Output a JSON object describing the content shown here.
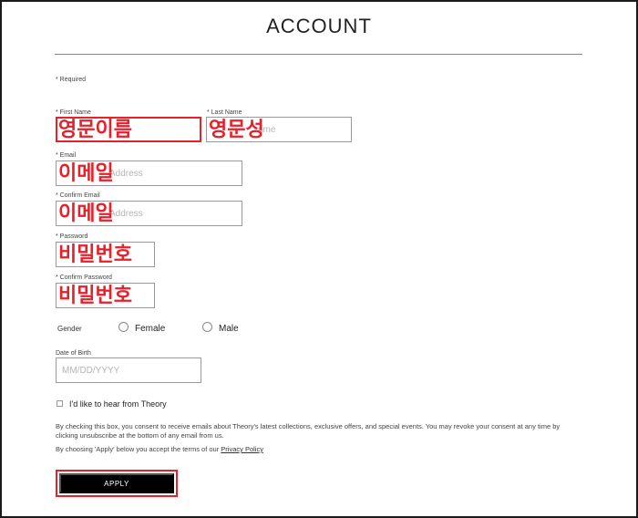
{
  "page": {
    "title": "ACCOUNT",
    "required_note": "* Required"
  },
  "form": {
    "first_name": {
      "label": "* First Name",
      "value": "영문이름",
      "placeholder": ""
    },
    "last_name": {
      "label": "* Last Name",
      "value": "영문성",
      "placeholder": "ame"
    },
    "email": {
      "label": "* Email",
      "value": "이메일",
      "placeholder": "Address"
    },
    "confirm_email": {
      "label": "* Confirm Email",
      "value": "이메일",
      "placeholder": "Address"
    },
    "password": {
      "label": "* Password",
      "value": "비밀번호"
    },
    "confirm_password": {
      "label": "* Confirm Password",
      "value": "비밀번호"
    },
    "gender": {
      "label": "Gender",
      "options": [
        "Female",
        "Male"
      ]
    },
    "dob": {
      "label": "Date of Birth",
      "placeholder": "MM/DD/YYYY"
    },
    "newsletter": {
      "label": "I'd like to hear from Theory"
    },
    "legal_text": "By checking this box, you consent to receive emails about Theory's latest collections, exclusive offers, and special events. You may revoke your consent at any time by clicking unsubscribe at the bottom of any email from us.",
    "terms_prefix": "By choosing 'Apply' below you accept the terms of our ",
    "privacy_link": "Privacy Policy",
    "apply_label": "APPLY"
  },
  "colors": {
    "annotation": "#e8202a",
    "button": "#000000"
  }
}
